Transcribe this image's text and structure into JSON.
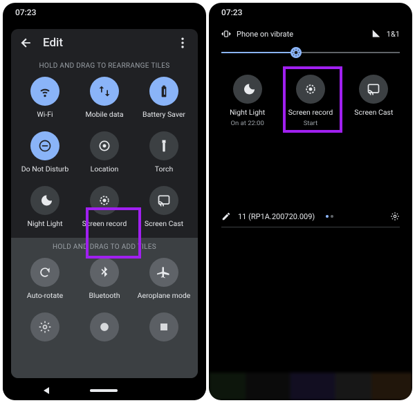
{
  "left": {
    "time": "07:23",
    "title": "Edit",
    "rearrange_label": "HOLD AND DRAG TO REARRANGE TILES",
    "add_label": "HOLD AND DRAG TO ADD TILES",
    "tiles_active": [
      {
        "name": "wifi",
        "label": "Wi-Fi",
        "active": true
      },
      {
        "name": "mobile-data",
        "label": "Mobile data",
        "active": true
      },
      {
        "name": "battery-saver",
        "label": "Battery Saver",
        "active": true
      },
      {
        "name": "dnd",
        "label": "Do Not Disturb",
        "active": true
      },
      {
        "name": "location",
        "label": "Location",
        "active": false
      },
      {
        "name": "torch",
        "label": "Torch",
        "active": false
      },
      {
        "name": "night-light",
        "label": "Night Light",
        "active": false
      },
      {
        "name": "screen-record",
        "label": "Screen record",
        "active": false
      },
      {
        "name": "screen-cast",
        "label": "Screen Cast",
        "active": false
      }
    ],
    "tiles_add": [
      {
        "name": "auto-rotate",
        "label": "Auto-rotate"
      },
      {
        "name": "bluetooth",
        "label": "Bluetooth"
      },
      {
        "name": "aeroplane",
        "label": "Aeroplane mode"
      }
    ]
  },
  "right": {
    "time": "07:23",
    "vibrate_text": "Phone on vibrate",
    "signal_text": "1&1",
    "brightness_pct": 42,
    "tiles": [
      {
        "name": "night-light",
        "label": "Night Light",
        "sub": "On at 22:00"
      },
      {
        "name": "screen-record",
        "label": "Screen record",
        "sub": "Start"
      },
      {
        "name": "screen-cast",
        "label": "Screen Cast",
        "sub": ""
      }
    ],
    "build": "11 (RP1A.200720.009)"
  },
  "highlight_color": "#a020f0"
}
